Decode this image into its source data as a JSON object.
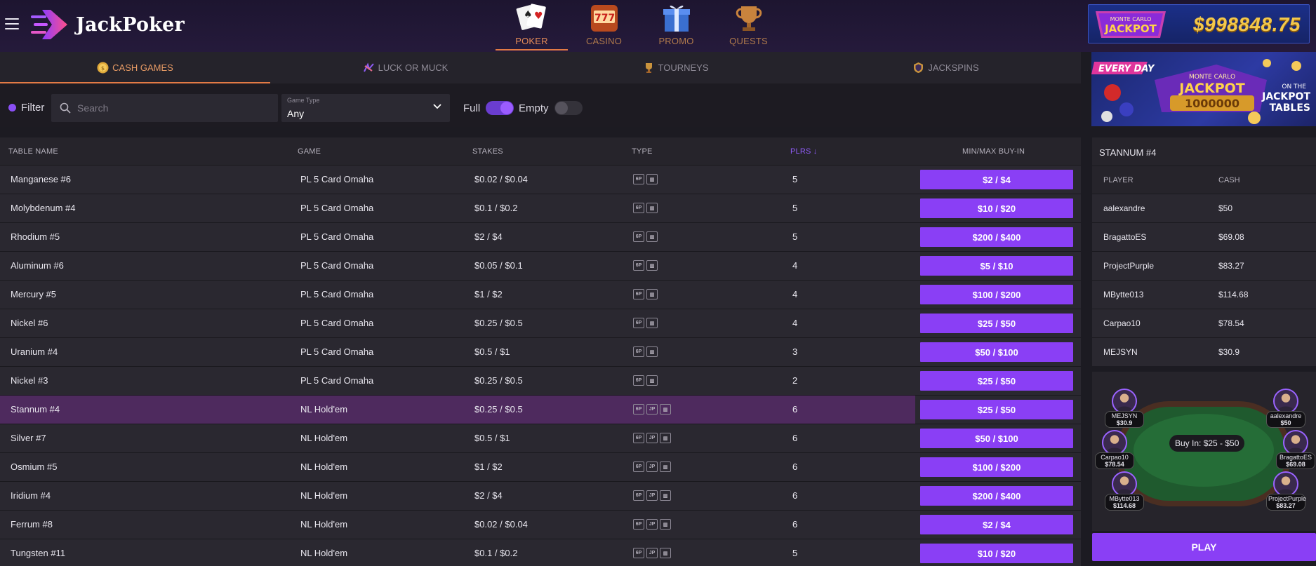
{
  "brand": {
    "name": "JackPoker"
  },
  "topnav": [
    {
      "label": "POKER",
      "icon": "poker-cards-icon",
      "active": true
    },
    {
      "label": "CASINO",
      "icon": "slot-machine-icon",
      "active": false
    },
    {
      "label": "PROMO",
      "icon": "gift-box-icon",
      "active": false
    },
    {
      "label": "QUESTS",
      "icon": "trophy-icon",
      "active": false
    }
  ],
  "jackpot": {
    "badge_line1": "MONTE CARLO",
    "badge_line2": "JACKPOT",
    "amount": "$998848.75"
  },
  "subtabs": [
    {
      "label": "CASH GAMES",
      "icon": "coin-icon",
      "active": true
    },
    {
      "label": "LUCK OR MUCK",
      "icon": "luck-icon",
      "active": false
    },
    {
      "label": "TOURNEYS",
      "icon": "trophy-icon",
      "active": false
    },
    {
      "label": "JACKSPINS",
      "icon": "shield-icon",
      "active": false
    }
  ],
  "filter": {
    "label": "Filter",
    "search_placeholder": "Search",
    "game_type_label": "Game Type",
    "game_type_value": "Any",
    "full_label": "Full",
    "full_on": true,
    "empty_label": "Empty",
    "empty_on": false
  },
  "table": {
    "headers": {
      "name": "TABLE NAME",
      "game": "GAME",
      "stakes": "STAKES",
      "type": "TYPE",
      "plrs": "PLRS ↓",
      "buyin": "MIN/MAX BUY-IN"
    },
    "rows": [
      {
        "name": "Manganese #6",
        "game": "PL 5 Card Omaha",
        "stakes": "$0.02 / $0.04",
        "jp": false,
        "plrs": "5",
        "buyin": "$2 / $4"
      },
      {
        "name": "Molybdenum #4",
        "game": "PL 5 Card Omaha",
        "stakes": "$0.1 / $0.2",
        "jp": false,
        "plrs": "5",
        "buyin": "$10 / $20"
      },
      {
        "name": "Rhodium #5",
        "game": "PL 5 Card Omaha",
        "stakes": "$2 / $4",
        "jp": false,
        "plrs": "5",
        "buyin": "$200 / $400"
      },
      {
        "name": "Aluminum #6",
        "game": "PL 5 Card Omaha",
        "stakes": "$0.05 / $0.1",
        "jp": false,
        "plrs": "4",
        "buyin": "$5 / $10"
      },
      {
        "name": "Mercury #5",
        "game": "PL 5 Card Omaha",
        "stakes": "$1 / $2",
        "jp": false,
        "plrs": "4",
        "buyin": "$100 / $200"
      },
      {
        "name": "Nickel #6",
        "game": "PL 5 Card Omaha",
        "stakes": "$0.25 / $0.5",
        "jp": false,
        "plrs": "4",
        "buyin": "$25 / $50"
      },
      {
        "name": "Uranium #4",
        "game": "PL 5 Card Omaha",
        "stakes": "$0.5 / $1",
        "jp": false,
        "plrs": "3",
        "buyin": "$50 / $100"
      },
      {
        "name": "Nickel #3",
        "game": "PL 5 Card Omaha",
        "stakes": "$0.25 / $0.5",
        "jp": false,
        "plrs": "2",
        "buyin": "$25 / $50"
      },
      {
        "name": "Stannum #4",
        "game": "NL Hold'em",
        "stakes": "$0.25 / $0.5",
        "jp": true,
        "plrs": "6",
        "buyin": "$25 / $50",
        "selected": true
      },
      {
        "name": "Silver #7",
        "game": "NL Hold'em",
        "stakes": "$0.5 / $1",
        "jp": true,
        "plrs": "6",
        "buyin": "$50 / $100"
      },
      {
        "name": "Osmium #5",
        "game": "NL Hold'em",
        "stakes": "$1 / $2",
        "jp": true,
        "plrs": "6",
        "buyin": "$100 / $200"
      },
      {
        "name": "Iridium #4",
        "game": "NL Hold'em",
        "stakes": "$2 / $4",
        "jp": true,
        "plrs": "6",
        "buyin": "$200 / $400"
      },
      {
        "name": "Ferrum #8",
        "game": "NL Hold'em",
        "stakes": "$0.02 / $0.04",
        "jp": true,
        "plrs": "6",
        "buyin": "$2 / $4"
      },
      {
        "name": "Tungsten #11",
        "game": "NL Hold'em",
        "stakes": "$0.1 / $0.2",
        "jp": true,
        "plrs": "5",
        "buyin": "$10 / $20"
      }
    ],
    "type_icon_6p": "6P",
    "type_icon_jp": "JP"
  },
  "promo": {
    "ribbon": "EVERY DAY",
    "line1": "MONTE CARLO",
    "line2": "JACKPOT",
    "amount": "1000000",
    "side1": "ON THE",
    "side2": "JACKPOT",
    "side3": "TABLES"
  },
  "selected_table": {
    "title": "STANNUM #4",
    "col_player": "PLAYER",
    "col_cash": "CASH",
    "players": [
      {
        "name": "aalexandre",
        "cash": "$50"
      },
      {
        "name": "BragattoES",
        "cash": "$69.08"
      },
      {
        "name": "ProjectPurple",
        "cash": "$83.27"
      },
      {
        "name": "MBytte013",
        "cash": "$114.68"
      },
      {
        "name": "Carpao10",
        "cash": "$78.54"
      },
      {
        "name": "MEJSYN",
        "cash": "$30.9"
      }
    ],
    "buy_in_text": "Buy In: $25 - $50",
    "play_label": "PLAY"
  },
  "colors": {
    "accent": "#8a3ff5",
    "orange": "#e27a45",
    "selected_row": "#4e2a5e"
  }
}
